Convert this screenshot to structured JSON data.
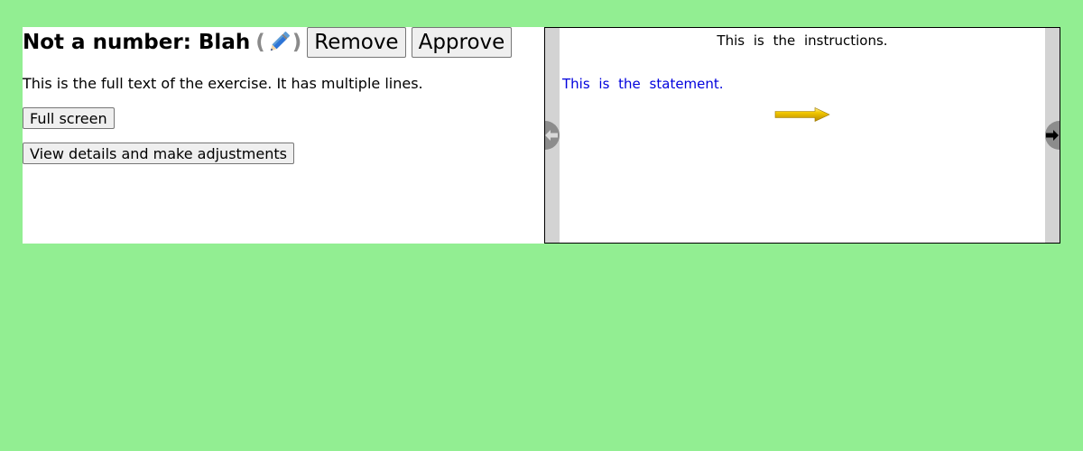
{
  "header": {
    "title": "Not a number: Blah",
    "paren_open": "(",
    "paren_close": ")",
    "remove_label": "Remove",
    "approve_label": "Approve"
  },
  "exercise": {
    "full_text": "This is the full text of the exercise. It has multiple lines.",
    "full_screen_label": "Full screen",
    "details_label": "View details and make adjustments"
  },
  "preview": {
    "instructions": "This is the instructions.",
    "statement": "This is the statement.",
    "prev_icon": "arrow-left-icon",
    "next_icon": "arrow-right-icon",
    "arrow_icon": "yellow-arrow-icon"
  },
  "colors": {
    "background": "#92ee92",
    "statement": "#0000dd",
    "arrow": "#e6b800",
    "nav_bar": "#d3d3d3"
  }
}
